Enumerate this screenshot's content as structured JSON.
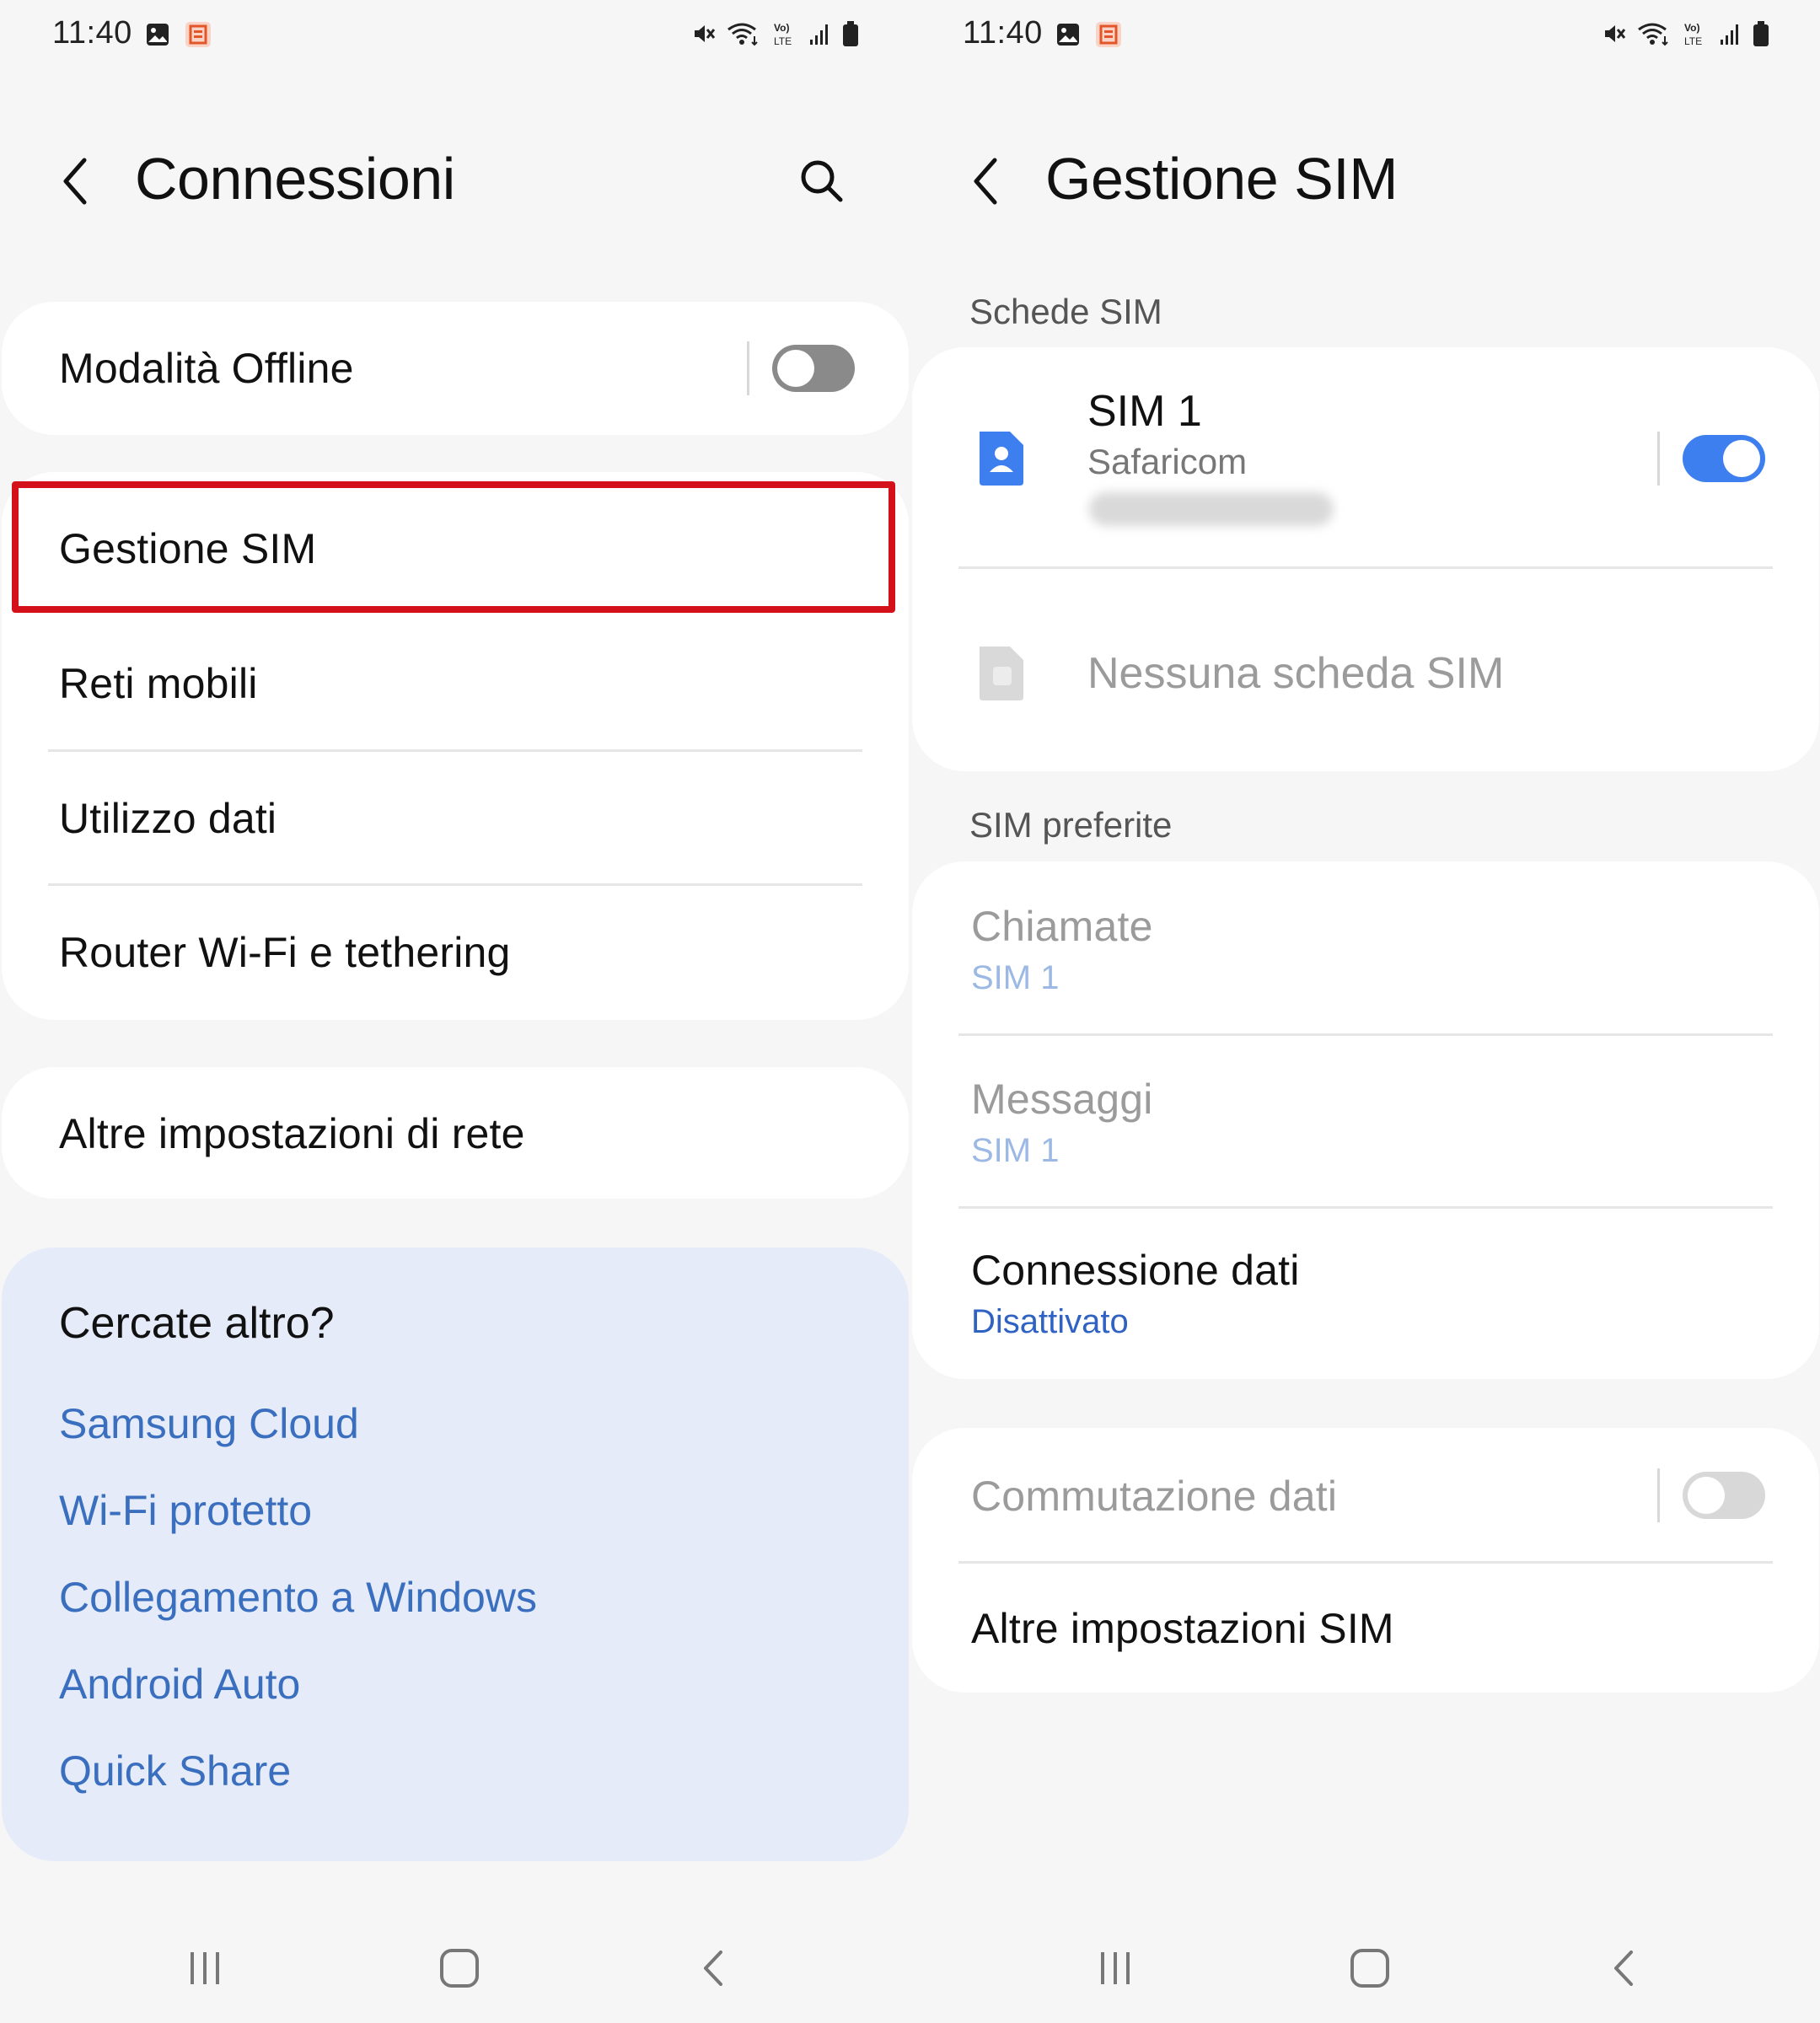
{
  "status_bar": {
    "time": "11:40",
    "icons": [
      "gallery-icon",
      "office-icon",
      "mute-icon",
      "wifi-icon",
      "volte-icon",
      "signal-icon",
      "battery-icon"
    ]
  },
  "left": {
    "title": "Connessioni",
    "airplane": {
      "label": "Modalità Offline",
      "on": false
    },
    "items": [
      {
        "label": "Gestione SIM"
      },
      {
        "label": "Reti mobili"
      },
      {
        "label": "Utilizzo dati"
      },
      {
        "label": "Router Wi-Fi e tethering"
      }
    ],
    "more_settings": {
      "label": "Altre impostazioni di rete"
    },
    "search_more": {
      "heading": "Cercate altro?",
      "links": [
        "Samsung Cloud",
        "Wi-Fi protetto",
        "Collegamento a Windows",
        "Android Auto",
        "Quick Share"
      ]
    }
  },
  "right": {
    "title": "Gestione SIM",
    "sim_cards_header": "Schede SIM",
    "sim1": {
      "name": "SIM 1",
      "carrier": "Safaricom",
      "on": true
    },
    "no_sim": {
      "label": "Nessuna scheda SIM"
    },
    "preferred_header": "SIM preferite",
    "preferred": {
      "calls": {
        "label": "Chiamate",
        "value": "SIM 1"
      },
      "messages": {
        "label": "Messaggi",
        "value": "SIM 1"
      },
      "data": {
        "label": "Connessione dati",
        "value": "Disattivato"
      }
    },
    "data_switch": {
      "label": "Commutazione dati",
      "on": false
    },
    "more_sim": {
      "label": "Altre impostazioni SIM"
    }
  },
  "colors": {
    "accent": "#3e7ff0",
    "link": "#3a6fbf",
    "highlight": "#d4101a",
    "background": "#f6f6f6",
    "search_card": "#e5ebf8"
  }
}
